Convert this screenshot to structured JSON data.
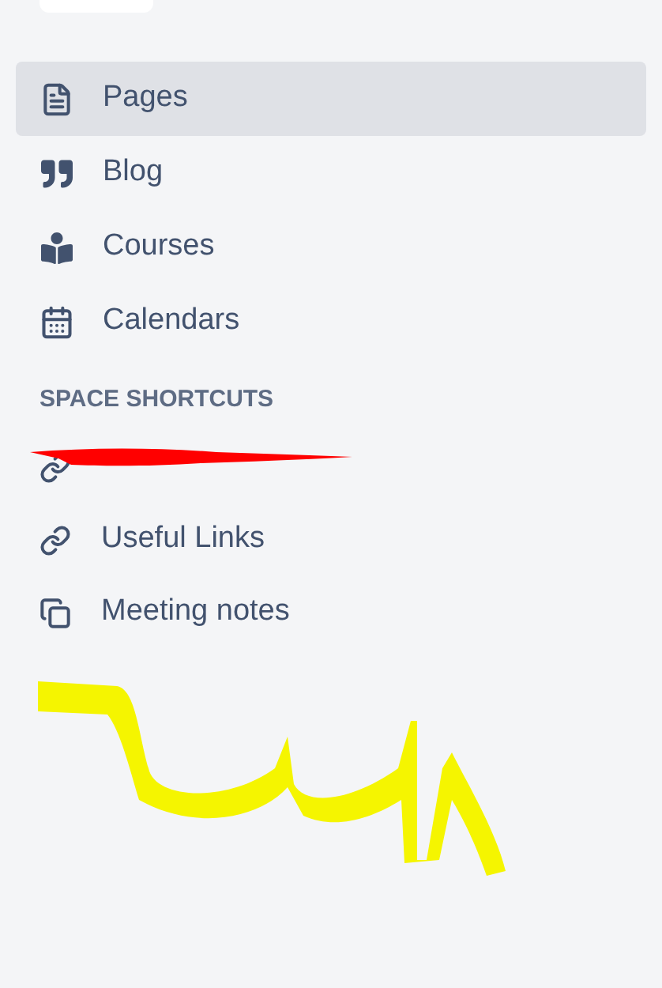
{
  "nav": [
    {
      "label": "Pages",
      "selected": true
    },
    {
      "label": "Blog",
      "selected": false
    },
    {
      "label": "Courses",
      "selected": false
    },
    {
      "label": "Calendars",
      "selected": false
    }
  ],
  "shortcuts_heading": "SPACE SHORTCUTS",
  "shortcuts": [
    {
      "kind": "redacted"
    },
    {
      "kind": "link",
      "label": "Useful Links"
    },
    {
      "kind": "link",
      "label": "Meeting notes"
    }
  ]
}
